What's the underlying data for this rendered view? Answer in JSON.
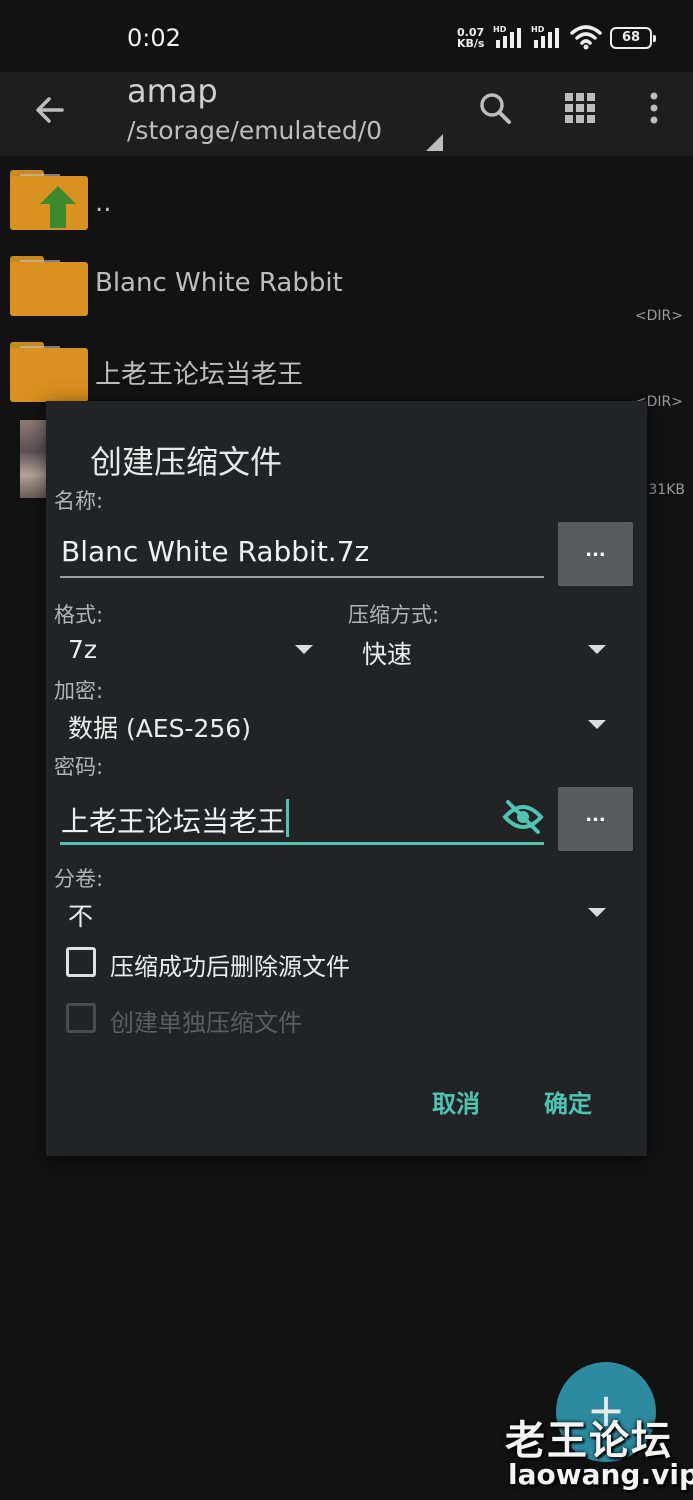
{
  "status_bar": {
    "time": "0:02",
    "net_speed_value": "0.07",
    "net_speed_unit": "KB/s",
    "hd1": "HD",
    "hd2": "HD",
    "battery": "68"
  },
  "toolbar": {
    "title": "amap",
    "path": "/storage/emulated/0",
    "icons": [
      "back-arrow-icon",
      "search-icon",
      "grid-view-icon",
      "more-vert-icon"
    ]
  },
  "files": [
    {
      "name": "..",
      "type": "parent"
    },
    {
      "name": "Blanc White Rabbit",
      "tag": "<DIR>"
    },
    {
      "name": "上老王论坛当老王",
      "tag": "<DIR>"
    },
    {
      "size": "31KB"
    }
  ],
  "dialog": {
    "title": "创建压缩文件",
    "name_label": "名称:",
    "name_value": "Blanc White Rabbit.7z",
    "browse_label": "...",
    "format_label": "格式:",
    "format_value": "7z",
    "method_label": "压缩方式:",
    "method_value": "快速",
    "encryption_label": "加密:",
    "encryption_value": "数据 (AES-256)",
    "password_label": "密码:",
    "password_value": "上老王论坛当老王",
    "password_more_label": "...",
    "split_label": "分卷:",
    "split_value": "不",
    "delete_source_label": "压缩成功后删除源文件",
    "delete_source_checked": false,
    "separate_archives_label": "创建单独压缩文件",
    "separate_archives_enabled": false,
    "cancel_label": "取消",
    "ok_label": "确定"
  },
  "watermark": {
    "text": "老王论坛",
    "url": "laowang.vip"
  },
  "colors": {
    "accent": "#4fc3b4",
    "folder": "#d9911f",
    "background": "#121212",
    "dialog": "#222324"
  }
}
